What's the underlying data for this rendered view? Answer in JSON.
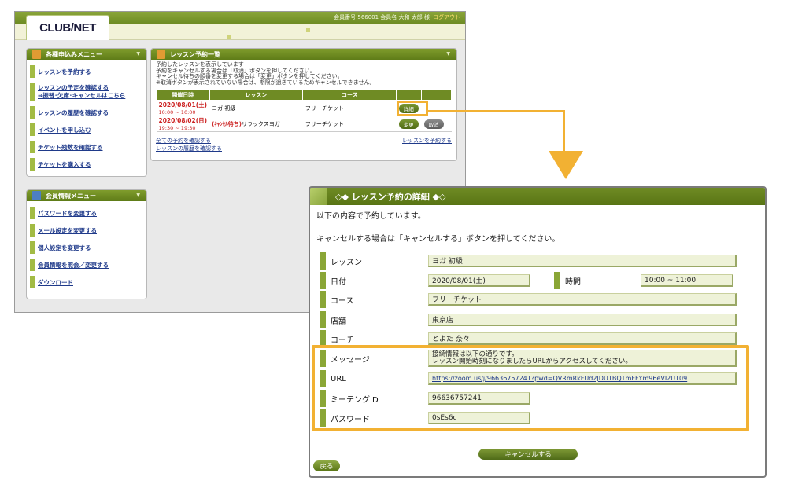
{
  "portal": {
    "member_info": "会員番号 566001  会員名 大和 太郎 様",
    "logout": "ログアウト",
    "logo": "CLUB/NET",
    "apply_menu": {
      "title": "各種申込みメニュー",
      "items": [
        {
          "label": "レッスンを予約する"
        },
        {
          "line1": "レッスンの予定を確認する",
          "line2": "⇒振替･欠席･キャンセルはこちら"
        },
        {
          "label": "レッスンの履歴を確認する"
        },
        {
          "label": "イベントを申し込む"
        },
        {
          "label": "チケット残数を確認する"
        },
        {
          "label": "チケットを購入する"
        }
      ]
    },
    "member_menu": {
      "title": "会員情報メニュー",
      "items": [
        {
          "label": "パスワードを変更する"
        },
        {
          "label": "メール設定を変更する"
        },
        {
          "label": "個人設定を変更する"
        },
        {
          "label": "会員情報を照会／変更する"
        },
        {
          "label": "ダウンロード"
        }
      ]
    },
    "reservations": {
      "title": "レッスン予約一覧",
      "intro": [
        "予約したレッスンを表示しています",
        "予約をキャンセルする場合は「取消」ボタンを押してください。",
        "キャンセル待ちの順番を変更する場合は「変更」ボタンを押してください。",
        "※取消ボタンが表示されていない場合は、期限が過ぎているためキャンセルできません。"
      ],
      "columns": [
        "開催日時",
        "レッスン",
        "コース"
      ],
      "rows": [
        {
          "date": "2020/08/01(土)",
          "time": "10:00 ~ 10:00",
          "tag": "",
          "lesson": "ヨガ 初級",
          "course": "フリーチケット",
          "button1": "詳細",
          "button2": ""
        },
        {
          "date": "2020/08/02(日)",
          "time": "19:30 ~ 19:30",
          "tag": "(ｷｬﾝｾﾙ待ち)",
          "lesson": "リラックスヨガ",
          "course": "フリーチケット",
          "button1": "変更",
          "button2": "取消"
        }
      ],
      "link_all": "全ての予約を確認する",
      "link_history": "レッスンの履歴を確認する",
      "link_reserve": "レッスンを予約する"
    }
  },
  "detail": {
    "title": "◇◆ レッスン予約の詳細 ◆◇",
    "intro1": "以下の内容で予約しています。",
    "intro2": "キャンセルする場合は「キャンセルする」ボタンを押してください。",
    "fields": {
      "lesson": {
        "label": "レッスン",
        "value": "ヨガ 初級"
      },
      "date": {
        "label": "日付",
        "value": "2020/08/01(土)"
      },
      "time": {
        "label": "時間",
        "value": "10:00 ~ 11:00"
      },
      "course": {
        "label": "コース",
        "value": "フリーチケット"
      },
      "store": {
        "label": "店舗",
        "value": "東京店"
      },
      "coach": {
        "label": "コーチ",
        "value": "とよた 奈々"
      },
      "message": {
        "label": "メッセージ",
        "line1": "接続情報は以下の通りです。",
        "line2": "レッスン開始時刻になりましたらURLからアクセスしてください。"
      },
      "url": {
        "label": "URL",
        "value": "https://zoom.us/j/96636757241?pwd=QVRmRkFUd2JDU1BQTmFFYm96eVI2UT09"
      },
      "meeting_id": {
        "label": "ミーテングID",
        "value": "96636757241"
      },
      "password": {
        "label": "パスワード",
        "value": "0sEs6c"
      }
    },
    "cancel_button": "キャンセルする",
    "back_button": "戻る"
  },
  "colors": {
    "accent_green": "#6f8b24",
    "highlight_orange": "#f2b133",
    "link_blue": "#1f3a8a",
    "alert_red": "#cc2222"
  }
}
